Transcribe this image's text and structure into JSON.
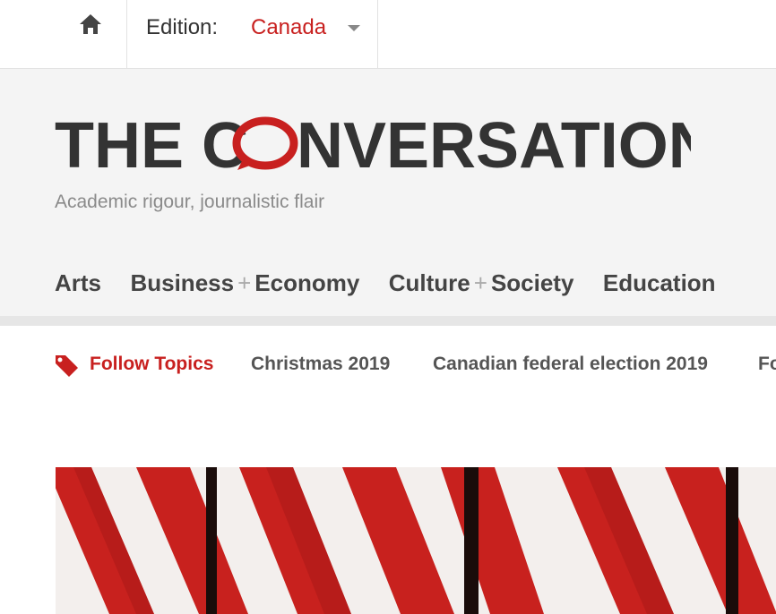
{
  "topbar": {
    "home_icon": "home-icon",
    "edition_label": "Edition:",
    "edition_value": "Canada",
    "caret_icon": "caret-down-icon"
  },
  "brand": {
    "logo_text_left": "THE C",
    "logo_text_right": "NVERSATION",
    "tagline": "Academic rigour, journalistic flair",
    "accent_color": "#c8201f"
  },
  "nav": {
    "arts": "Arts",
    "business_a": "Business",
    "business_b": "Economy",
    "culture_a": "Culture",
    "culture_b": "Society",
    "education": "Education",
    "plus": "+"
  },
  "topics": {
    "tag_icon": "tag-icon",
    "follow_label": "Follow Topics",
    "items": [
      "Christmas 2019",
      "Canadian federal election 2019",
      "Fo"
    ]
  },
  "hero": {
    "image_name": "candy-cane-stripes"
  }
}
